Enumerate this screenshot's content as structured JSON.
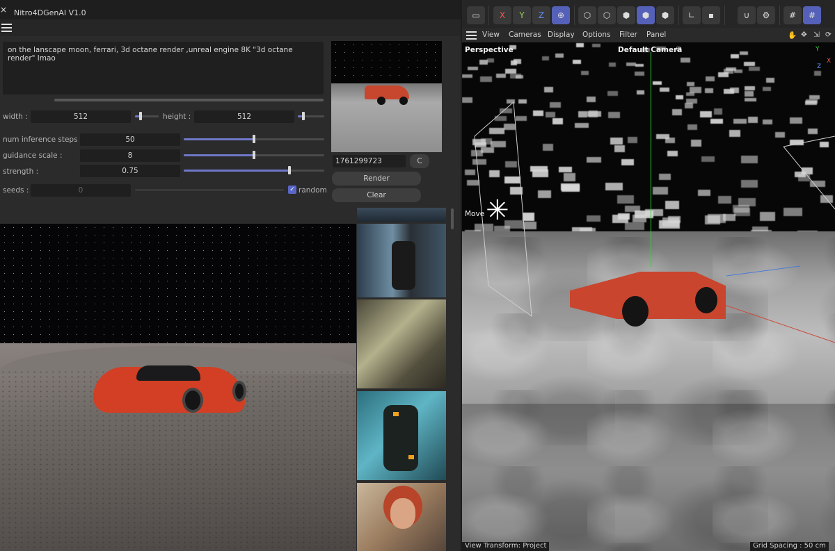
{
  "plugin": {
    "window_title": "Nitro4DGenAI V1.0",
    "close_glyph": "×",
    "prompt": "on the lanscape moon, ferrari, 3d octane render ,unreal engine 8K \"3d octane render\" lmao",
    "width_label": "width :",
    "width_value": "512",
    "height_label": "height :",
    "height_value": "512",
    "steps_label": "num inference steps :",
    "steps_value": "50",
    "steps_slider": 0.5,
    "guidance_label": "guidance scale :",
    "guidance_value": "8",
    "guidance_slider": 0.5,
    "strength_label": "strength :",
    "strength_value": "0.75",
    "strength_slider": 0.75,
    "seeds_label": "seeds :",
    "seeds_value": "0",
    "random_label": "random",
    "random_checked": true,
    "seed_number": "1761299723",
    "c_button": "C",
    "render_button": "Render",
    "clear_button": "Clear",
    "accent_color": "#5a67c8"
  },
  "c4d": {
    "toolbar": {
      "axis_x": "X",
      "axis_y": "Y",
      "axis_z": "Z"
    },
    "menu": [
      "View",
      "Cameras",
      "Display",
      "Options",
      "Filter",
      "Panel"
    ],
    "viewport": {
      "projection": "Perspective",
      "camera": "Default Camera",
      "tool": "Move",
      "status_left": "View Transform: Project",
      "status_right": "Grid Spacing : 50 cm",
      "axis_y_label": "Y",
      "axis_x_label": "X",
      "axis_z_label": "Z"
    }
  },
  "icons": {
    "hamburger": "hamburger-icon",
    "camera_icon": "camera-link-icon",
    "move_gizmo": "move-gizmo-icon"
  }
}
